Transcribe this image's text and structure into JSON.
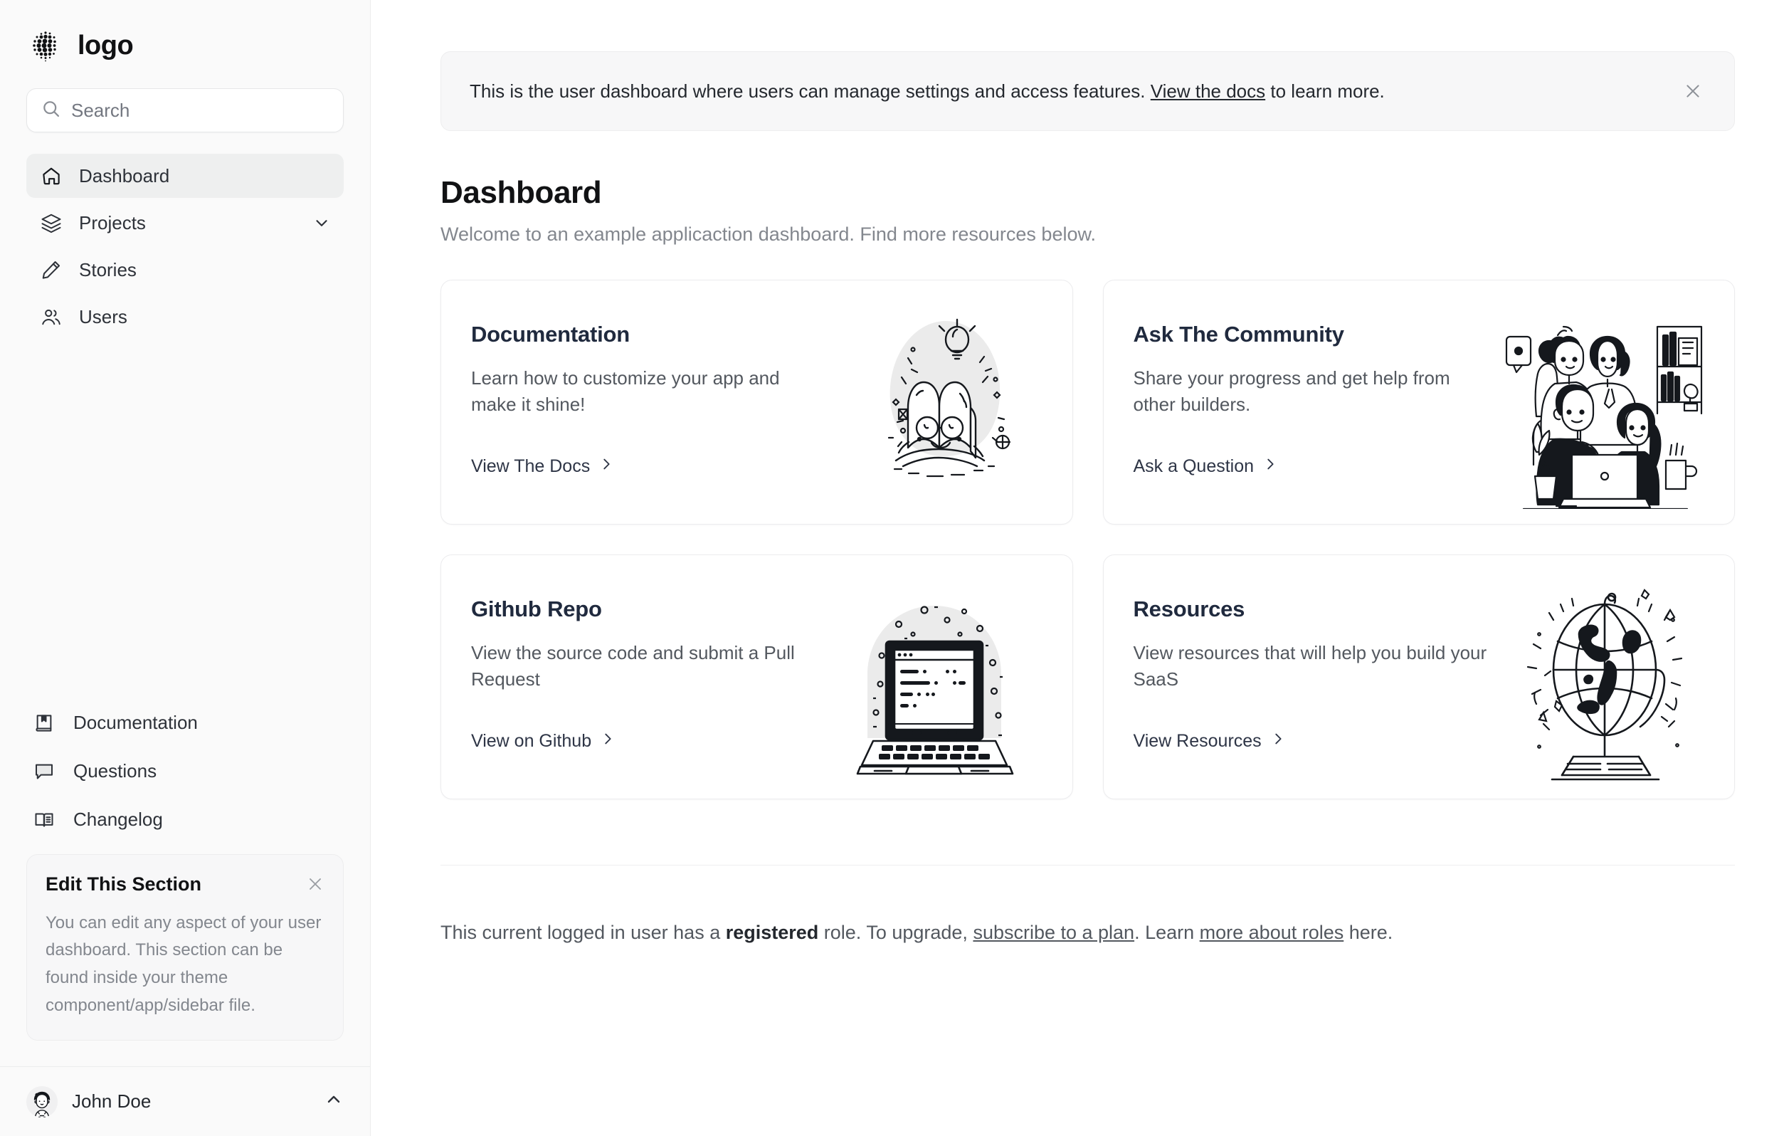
{
  "sidebar": {
    "brand": {
      "name": "logo",
      "logo_icon": "dotted-sphere-logo"
    },
    "search": {
      "placeholder": "Search",
      "value": "",
      "icon": "search-icon"
    },
    "nav_main": [
      {
        "label": "Dashboard",
        "icon": "home-icon",
        "active": true,
        "chevron": ""
      },
      {
        "label": "Projects",
        "icon": "layers-icon",
        "active": false,
        "chevron": "chevron-down-icon"
      },
      {
        "label": "Stories",
        "icon": "pencil-icon",
        "active": false,
        "chevron": ""
      },
      {
        "label": "Users",
        "icon": "users-icon",
        "active": false,
        "chevron": ""
      }
    ],
    "nav_secondary": [
      {
        "label": "Documentation",
        "icon": "book-bookmark-icon"
      },
      {
        "label": "Questions",
        "icon": "chat-bubble-icon"
      },
      {
        "label": "Changelog",
        "icon": "open-book-icon"
      }
    ],
    "edit_card": {
      "title": "Edit This Section",
      "body": "You can edit any aspect of your user dashboard. This section can be found inside your theme component/app/sidebar file.",
      "close_icon": "close-icon"
    },
    "footer": {
      "user_name": "John Doe",
      "avatar_icon": "user-avatar",
      "chevron": "chevron-up-icon"
    }
  },
  "main": {
    "banner": {
      "text_before": "This is the user dashboard where users can manage settings and access features. ",
      "link_label": "View the docs",
      "text_after": " to learn more.",
      "close_icon": "close-icon"
    },
    "page_title": "Dashboard",
    "page_subtitle": "Welcome to an example applicaction dashboard. Find more resources below.",
    "cards": [
      {
        "title": "Documentation",
        "desc": "Learn how to customize your app and make it shine!",
        "link_label": "View The Docs",
        "link_icon": "chevron-right-icon",
        "art": "open-book-illustration"
      },
      {
        "title": "Ask The Community",
        "desc": "Share your progress and get help from other builders.",
        "link_label": "Ask a Question",
        "link_icon": "chevron-right-icon",
        "art": "community-people-illustration"
      },
      {
        "title": "Github Repo",
        "desc": "View the source code and submit a Pull Request",
        "link_label": "View on Github",
        "link_icon": "chevron-right-icon",
        "art": "laptop-code-illustration"
      },
      {
        "title": "Resources",
        "desc": "View resources that will help you build your SaaS",
        "link_label": "View Resources",
        "link_icon": "chevron-right-icon",
        "art": "globe-illustration"
      }
    ],
    "footnote": {
      "part1": "This current logged in user has a ",
      "role": "registered",
      "part2": " role. To upgrade, ",
      "link1": "subscribe to a plan",
      "part3": ". Learn ",
      "link2": "more about roles",
      "part4": " here."
    }
  },
  "colors": {
    "sidebar_bg": "#fafafa",
    "card_title": "#202a3e",
    "active_nav_bg": "#eeefef",
    "muted_text": "#83878e",
    "illustration_blob": "#ebebeb"
  }
}
